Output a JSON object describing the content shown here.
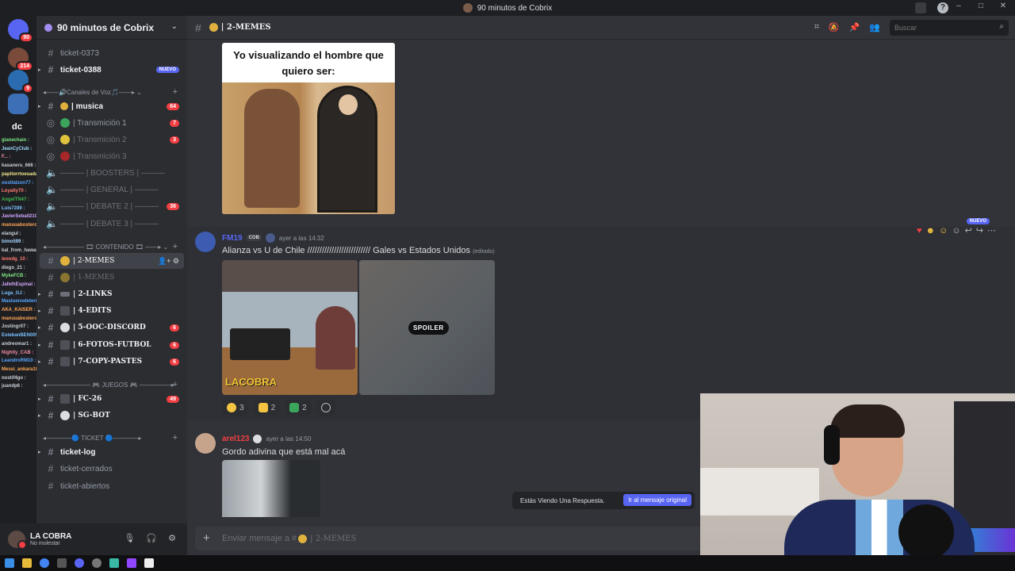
{
  "window": {
    "title": "90 minutos de Cobrix"
  },
  "rail": {
    "servers": [
      {
        "name": "home",
        "badge": "90",
        "color": "#5865f2"
      },
      {
        "name": "server-2",
        "badge": "214",
        "color": "#7a4a3a"
      },
      {
        "name": "server-3",
        "badge": "9",
        "color": "#2b6cb0"
      },
      {
        "name": "server-4",
        "badge": "",
        "color": "#3d6fb6"
      },
      {
        "name": "dc",
        "badge": "",
        "color": "#1e1f22"
      }
    ],
    "dc_label": "dc"
  },
  "chat_overlay": [
    {
      "name": "gianechain :",
      "color": "#7ee787"
    },
    {
      "name": "JeanCyClub :",
      "color": "#9cdcfe"
    },
    {
      "name": "F... :",
      "color": "#f38ba8"
    },
    {
      "name": "kasaneru_666 :",
      "color": "#c9d1d9"
    },
    {
      "name": "papitorrtoesada322 :",
      "color": "#f0e68c"
    },
    {
      "name": "oostlatzon77 :",
      "color": "#58a6ff"
    },
    {
      "name": "Loyalty70 :",
      "color": "#ff7b72"
    },
    {
      "name": "AngelTN47 :",
      "color": "#3fb950"
    },
    {
      "name": "Luis7289 :",
      "color": "#79c0ff"
    },
    {
      "name": "JavierSeba0210 :",
      "color": "#d2a8ff"
    },
    {
      "name": "manuuabostero :",
      "color": "#ffa657"
    },
    {
      "name": "elangul :",
      "color": "#c9d1d9"
    },
    {
      "name": "bimo599 :",
      "color": "#a5d6ff"
    },
    {
      "name": "kal_from_hawai22 :",
      "color": "#c9d1d9"
    },
    {
      "name": "leoodg_10 :",
      "color": "#ff7b72"
    },
    {
      "name": "diego_21 :",
      "color": "#c9d1d9"
    },
    {
      "name": "MykeFCB :",
      "color": "#7ee787"
    },
    {
      "name": "JafethEspinal :",
      "color": "#d2a8ff"
    },
    {
      "name": "Luga_GJ :",
      "color": "#79c0ff"
    },
    {
      "name": "Mastuenodeterno :",
      "color": "#58a6ff"
    },
    {
      "name": "AKA_KAISER :",
      "color": "#ffa657"
    },
    {
      "name": "manuuabostero :",
      "color": "#ffa657"
    },
    {
      "name": "Jostingr07 :",
      "color": "#c9d1d9"
    },
    {
      "name": "EstebanBEN005 :",
      "color": "#79c0ff"
    },
    {
      "name": "andreomar1 :",
      "color": "#c9d1d9"
    },
    {
      "name": "Nightly_CAB :",
      "color": "#f38ba8"
    },
    {
      "name": "LeandroRM10 :",
      "color": "#58a6ff"
    },
    {
      "name": "Messi_ankara1835846 :",
      "color": "#ffa657"
    },
    {
      "name": "nostif4go :",
      "color": "#c9d1d9"
    },
    {
      "name": "juandp6 :",
      "color": "#c9d1d9"
    }
  ],
  "server": {
    "name": "90 minutos de Cobrix"
  },
  "channels": {
    "ticket_0373": "ticket-0373",
    "ticket_0388": "ticket-0388",
    "nuevo": "NUEVO",
    "cat_voice": "Canales de Voz",
    "musica": "| musica",
    "musica_count": "64",
    "transmision1": "| Transmición 1",
    "transmision1_count": "7",
    "transmision2": "| Transmición 2",
    "transmision2_count": "3",
    "transmision3": "| Transmición 3",
    "boosters": "| BOOSTERS |",
    "general": "| GENERAL |",
    "debate2": "| DEBATE 2 |",
    "debate2_count": "36",
    "debate3": "| DEBATE 3 |",
    "cat_contenido": "CONTENIDO",
    "memes2": "| 2-MEMES",
    "memes1": "| 1-MEMES",
    "links2": "| 2-LINKS",
    "edits4": "| 4-EDITS",
    "ooc5": "| 5-OOC-DISCORD",
    "ooc5_count": "6",
    "fotos6": "| 6-FOTOS-FUTBOL",
    "fotos6_count": "6",
    "copy7": "| 7-COPY-PASTES",
    "copy7_count": "6",
    "cat_juegos": "JUEGOS",
    "fc26": "| FC-26",
    "fc26_count": "49",
    "sgbot": "| SG-BOT",
    "cat_ticket": "TICKET",
    "ticket_log": "ticket-log",
    "ticket_cerrados": "ticket-cerrados",
    "ticket_abiertos": "ticket-abiertos"
  },
  "user": {
    "name": "LA COBRA",
    "status": "No molestar"
  },
  "chat": {
    "channel": "| 2-MEMES",
    "search_placeholder": "Buscar",
    "meme_caption": "Yo visualizando el hombre que quiero ser:",
    "msg1": {
      "author": "FM19",
      "author_color": "#5865f2",
      "tag": "COB",
      "time": "ayer a las 14:32",
      "text": "Alianza vs U de Chile ////////////////////////// Gales vs Estados Unidos",
      "edited": "(editado)",
      "image_logo": "LACOBRA",
      "spoiler": "SPOILER",
      "reactions": [
        {
          "emoji": "rofl",
          "count": "3",
          "color": "#f5c542"
        },
        {
          "emoji": "clap",
          "count": "2",
          "color": "#f5c542"
        },
        {
          "emoji": "check",
          "count": "2",
          "color": "#3ba55c"
        }
      ],
      "new_label": "NUEVO"
    },
    "msg2": {
      "author": "arel123",
      "author_color": "#f23f43",
      "time": "ayer a las 14:50",
      "text": "Gordo adivina que está mal acá"
    },
    "reply_notice": "Estás Viendo Una Respuesta.",
    "reply_button": "Ir al mensaje original",
    "composer_prefix": "Enviar mensaje a #",
    "composer_channel": "| 2-MEMES"
  }
}
